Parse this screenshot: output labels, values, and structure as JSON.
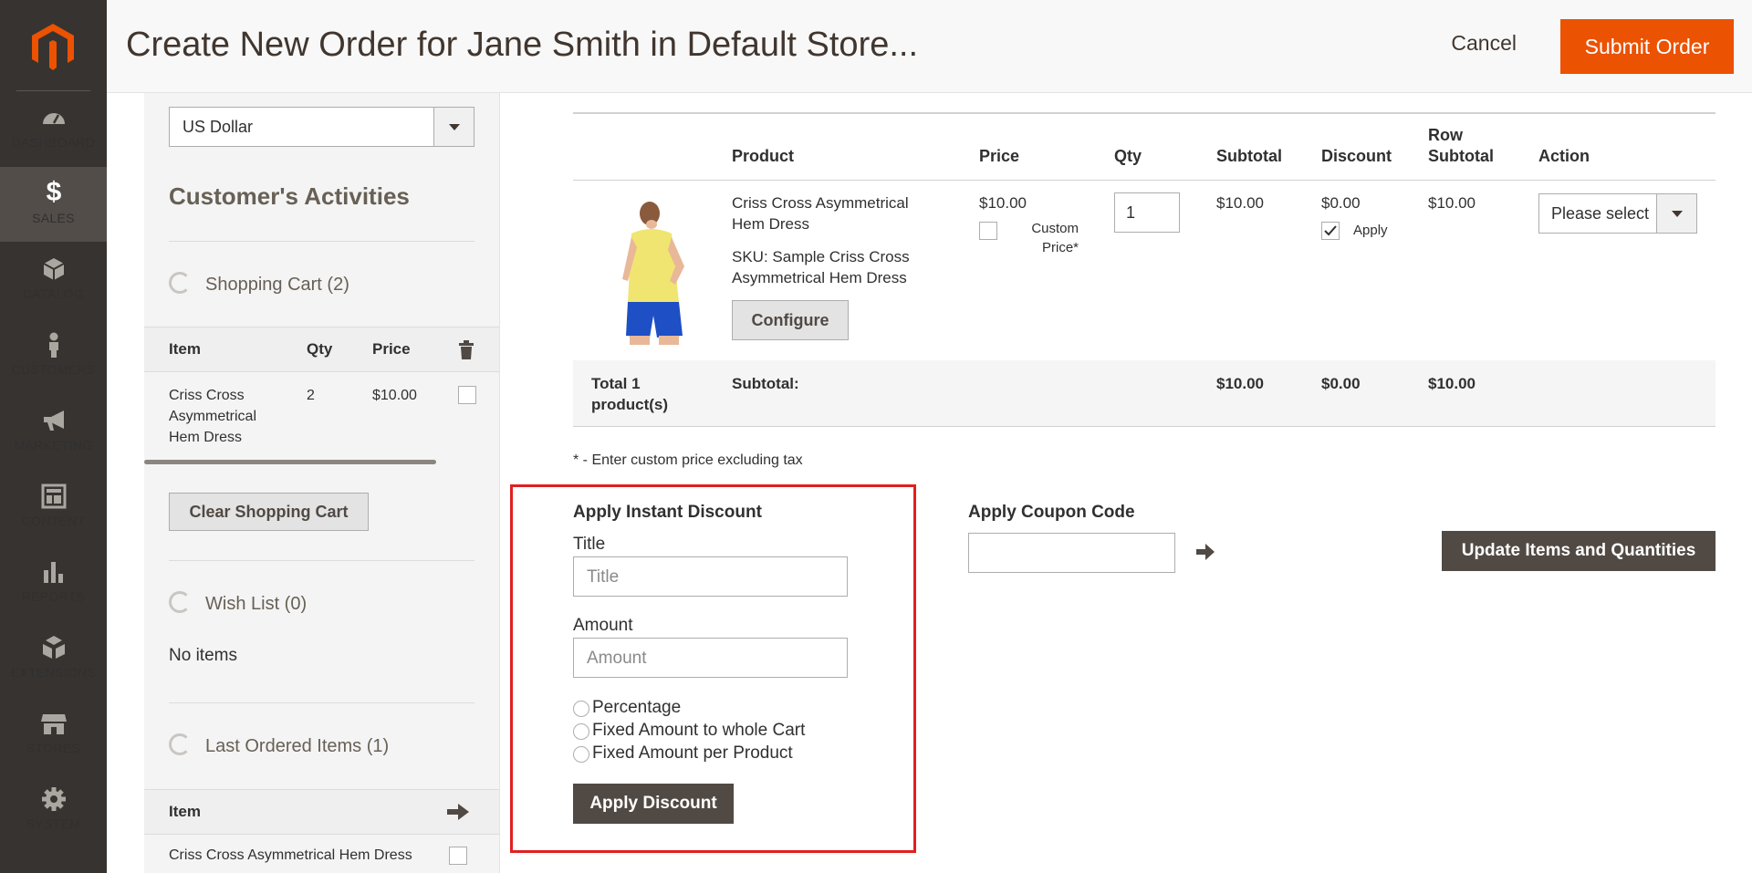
{
  "header": {
    "title": "Create New Order for Jane Smith in Default Store...",
    "cancel_label": "Cancel",
    "submit_label": "Submit Order"
  },
  "nav": {
    "items": [
      {
        "label": "DASHBOARD",
        "icon": "dashboard-icon"
      },
      {
        "label": "SALES",
        "icon": "dollar-icon",
        "active": true
      },
      {
        "label": "CATALOG",
        "icon": "cube-icon"
      },
      {
        "label": "CUSTOMERS",
        "icon": "person-icon"
      },
      {
        "label": "MARKETING",
        "icon": "megaphone-icon"
      },
      {
        "label": "CONTENT",
        "icon": "layout-icon"
      },
      {
        "label": "REPORTS",
        "icon": "bar-chart-icon"
      },
      {
        "label": "EXTENSIONS",
        "icon": "boxes-icon"
      },
      {
        "label": "STORES",
        "icon": "storefront-icon"
      },
      {
        "label": "SYSTEM",
        "icon": "gear-icon"
      }
    ]
  },
  "sidebar": {
    "currency": "US Dollar",
    "activities_title": "Customer's Activities",
    "shopping_cart": {
      "title": "Shopping Cart (2)",
      "columns": {
        "item": "Item",
        "qty": "Qty",
        "price": "Price"
      },
      "rows": [
        {
          "item": "Criss Cross Asymmetrical Hem Dress",
          "qty": "2",
          "price": "$10.00"
        }
      ],
      "clear_label": "Clear Shopping Cart"
    },
    "wish_list": {
      "title": "Wish List (0)",
      "empty": "No items"
    },
    "last_ordered": {
      "title": "Last Ordered Items (1)",
      "column_item": "Item",
      "rows": [
        {
          "item": "Criss Cross Asymmetrical Hem Dress"
        }
      ]
    }
  },
  "items_grid": {
    "columns": {
      "product": "Product",
      "price": "Price",
      "qty": "Qty",
      "subtotal": "Subtotal",
      "discount": "Discount",
      "row_subtotal_1": "Row",
      "row_subtotal_2": "Subtotal",
      "action": "Action"
    },
    "row": {
      "name": "Criss Cross Asymmetrical Hem Dress",
      "sku": "SKU: Sample Criss Cross Asymmetrical Hem Dress",
      "configure_label": "Configure",
      "price": "$10.00",
      "custom_price_label": "Custom Price*",
      "qty": "1",
      "subtotal": "$10.00",
      "discount": "$0.00",
      "apply_label": "Apply",
      "apply_checked": true,
      "row_subtotal": "$10.00",
      "action_placeholder": "Please select"
    },
    "totals": {
      "label": "Total 1 product(s)",
      "subtotal_label": "Subtotal:",
      "subtotal": "$10.00",
      "discount": "$0.00",
      "row_subtotal": "$10.00"
    },
    "note": "* - Enter custom price excluding tax"
  },
  "instant_discount": {
    "title": "Apply Instant Discount",
    "title_label": "Title",
    "title_placeholder": "Title",
    "amount_label": "Amount",
    "amount_placeholder": "Amount",
    "options": [
      "Percentage",
      "Fixed Amount to whole Cart",
      "Fixed Amount per Product"
    ],
    "apply_label": "Apply Discount",
    "highlight_color": "#e02020"
  },
  "coupon": {
    "title": "Apply Coupon Code"
  },
  "update_label": "Update Items and Quantities",
  "colors": {
    "brand_orange": "#eb5202",
    "nav_bg": "#373330",
    "dark_button": "#514943"
  }
}
